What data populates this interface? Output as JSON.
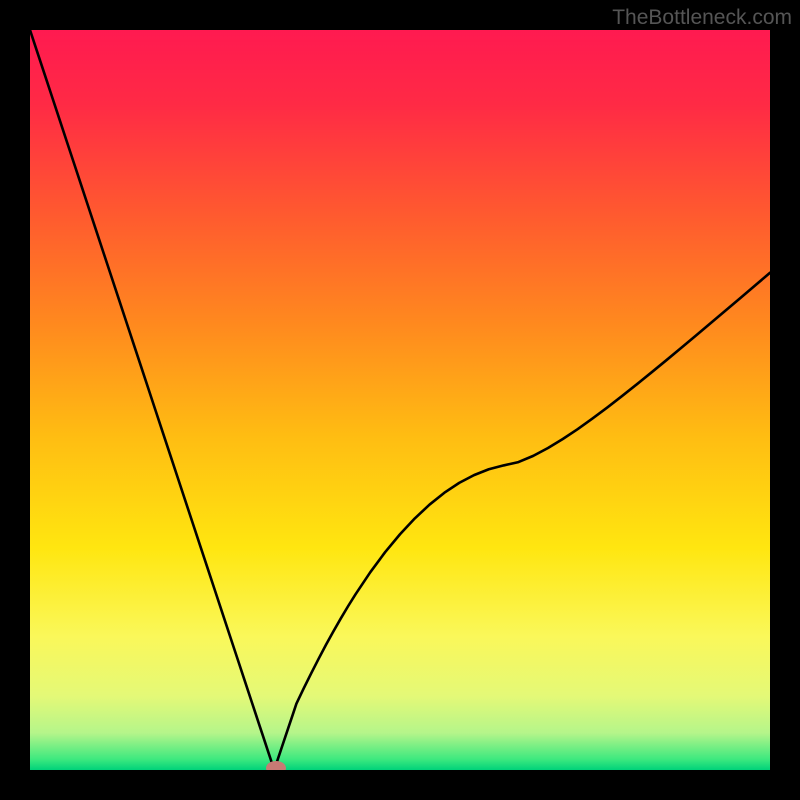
{
  "watermark": "TheBottleneck.com",
  "colors": {
    "frame_bg": "#000000",
    "gradient_stops": [
      {
        "offset": 0.0,
        "color": "#ff1a50"
      },
      {
        "offset": 0.1,
        "color": "#ff2a45"
      },
      {
        "offset": 0.25,
        "color": "#ff5a2f"
      },
      {
        "offset": 0.4,
        "color": "#ff8a1e"
      },
      {
        "offset": 0.55,
        "color": "#ffbd12"
      },
      {
        "offset": 0.7,
        "color": "#ffe610"
      },
      {
        "offset": 0.82,
        "color": "#faf85a"
      },
      {
        "offset": 0.9,
        "color": "#e4f977"
      },
      {
        "offset": 0.95,
        "color": "#b5f58a"
      },
      {
        "offset": 0.985,
        "color": "#3fe97f"
      },
      {
        "offset": 1.0,
        "color": "#00d27a"
      }
    ],
    "curve_stroke": "#000000",
    "marker_fill": "#c77a74"
  },
  "chart_data": {
    "type": "line",
    "title": "",
    "xlabel": "",
    "ylabel": "",
    "x": [
      0.0,
      0.01,
      0.02,
      0.03,
      0.04,
      0.05,
      0.06,
      0.07,
      0.08,
      0.09,
      0.1,
      0.11,
      0.12,
      0.13,
      0.14,
      0.15,
      0.16,
      0.17,
      0.18,
      0.19,
      0.2,
      0.21,
      0.22,
      0.23,
      0.24,
      0.25,
      0.26,
      0.27,
      0.28,
      0.29,
      0.3,
      0.305,
      0.31,
      0.315,
      0.32,
      0.322,
      0.325,
      0.328,
      0.33,
      0.332,
      0.335,
      0.338,
      0.34,
      0.345,
      0.35,
      0.355,
      0.36,
      0.37,
      0.38,
      0.39,
      0.4,
      0.41,
      0.42,
      0.43,
      0.44,
      0.46,
      0.48,
      0.5,
      0.52,
      0.54,
      0.56,
      0.58,
      0.6,
      0.62,
      0.64,
      0.66,
      0.68,
      0.7,
      0.72,
      0.74,
      0.76,
      0.78,
      0.8,
      0.82,
      0.84,
      0.86,
      0.88,
      0.9,
      0.92,
      0.94,
      0.96,
      0.98,
      1.0
    ],
    "y": [
      100.0,
      96.97,
      93.94,
      90.91,
      87.88,
      84.85,
      81.82,
      78.79,
      75.76,
      72.73,
      69.7,
      66.67,
      63.64,
      60.61,
      57.58,
      54.55,
      51.52,
      48.48,
      45.45,
      42.42,
      39.39,
      36.36,
      33.33,
      30.3,
      27.27,
      24.24,
      21.21,
      18.18,
      15.15,
      12.12,
      9.09,
      7.58,
      6.06,
      4.55,
      3.03,
      2.42,
      1.52,
      0.61,
      0.0,
      0.6,
      1.49,
      2.39,
      2.99,
      4.48,
      5.97,
      7.46,
      8.96,
      11.05,
      13.07,
      15.03,
      16.92,
      18.74,
      20.48,
      22.16,
      23.76,
      26.75,
      29.45,
      31.86,
      34.0,
      35.87,
      37.47,
      38.8,
      39.85,
      40.64,
      41.16,
      41.61,
      42.45,
      43.51,
      44.73,
      46.06,
      47.49,
      48.98,
      50.53,
      52.12,
      53.74,
      55.38,
      57.04,
      58.71,
      60.4,
      62.09,
      63.79,
      65.49,
      67.19
    ],
    "xlim": [
      0,
      1
    ],
    "ylim": [
      0,
      100
    ],
    "marker": {
      "x": 0.332,
      "y": 0.0
    }
  }
}
